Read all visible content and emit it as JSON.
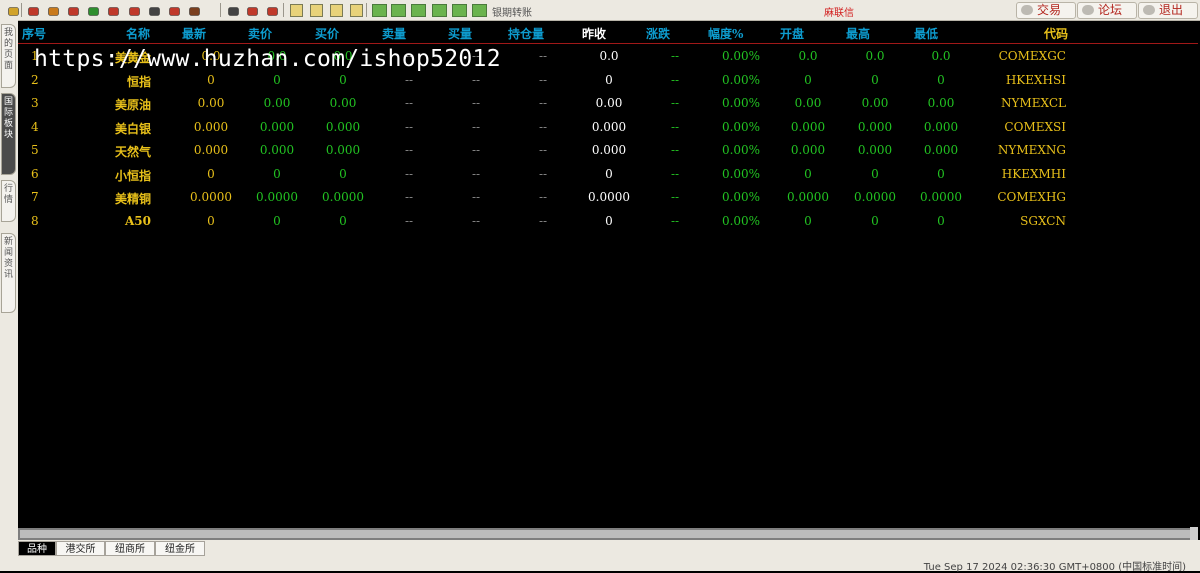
{
  "toolbar": {
    "icons": [
      "left-arrow",
      "home",
      "file",
      "chart-book",
      "refresh",
      "zoom-in",
      "zoom-out",
      "window",
      "pencil",
      "filter",
      "table",
      "line-chart",
      "trend-chart",
      "minute",
      "week",
      "month",
      "x",
      "add",
      "5",
      "15",
      "30",
      "60",
      "1h"
    ],
    "text_link": "银期转账",
    "login_link": "麻联信",
    "buttons": {
      "trade": "交易",
      "forum": "论坛",
      "exit": "退出"
    }
  },
  "side_tabs": [
    {
      "label": "我的页面"
    },
    {
      "label": "国际板块",
      "active": true
    },
    {
      "label": "行情"
    },
    {
      "label": "新闻资讯"
    }
  ],
  "table": {
    "headers": [
      "序号",
      "名称",
      "最新",
      "卖价",
      "买价",
      "卖量",
      "买量",
      "持仓量",
      "昨收",
      "涨跌",
      "幅度%",
      "开盘",
      "最高",
      "最低",
      "代码"
    ],
    "rows": [
      [
        "1",
        "美黄金",
        "0.0",
        "0.0",
        "0.0",
        "--",
        "--",
        "--",
        "0.0",
        "--",
        "0.00%",
        "0.0",
        "0.0",
        "0.0",
        "COMEXGC"
      ],
      [
        "2",
        "恒指",
        "0",
        "0",
        "0",
        "--",
        "--",
        "--",
        "0",
        "--",
        "0.00%",
        "0",
        "0",
        "0",
        "HKEXHSI"
      ],
      [
        "3",
        "美原油",
        "0.00",
        "0.00",
        "0.00",
        "--",
        "--",
        "--",
        "0.00",
        "--",
        "0.00%",
        "0.00",
        "0.00",
        "0.00",
        "NYMEXCL"
      ],
      [
        "4",
        "美白银",
        "0.000",
        "0.000",
        "0.000",
        "--",
        "--",
        "--",
        "0.000",
        "--",
        "0.00%",
        "0.000",
        "0.000",
        "0.000",
        "COMEXSI"
      ],
      [
        "5",
        "天然气",
        "0.000",
        "0.000",
        "0.000",
        "--",
        "--",
        "--",
        "0.000",
        "--",
        "0.00%",
        "0.000",
        "0.000",
        "0.000",
        "NYMEXNG"
      ],
      [
        "6",
        "小恒指",
        "0",
        "0",
        "0",
        "--",
        "--",
        "--",
        "0",
        "--",
        "0.00%",
        "0",
        "0",
        "0",
        "HKEXMHI"
      ],
      [
        "7",
        "美精铜",
        "0.0000",
        "0.0000",
        "0.0000",
        "--",
        "--",
        "--",
        "0.0000",
        "--",
        "0.00%",
        "0.0000",
        "0.0000",
        "0.0000",
        "COMEXHG"
      ],
      [
        "8",
        "A50",
        "0",
        "0",
        "0",
        "--",
        "--",
        "--",
        "0",
        "--",
        "0.00%",
        "0",
        "0",
        "0",
        "SGXCN"
      ]
    ]
  },
  "colors": {
    "header": "#0d9ccf",
    "code": "#e8c01a",
    "index": "#e8c01a",
    "name": "#e8c01a",
    "latest": "#e8c01a",
    "green": "#22c322",
    "white": "#ffffff",
    "gray": "#8a8a8a"
  },
  "watermark": "https://www.huzhan.com/ishop52012",
  "bottom_tabs": [
    {
      "label": "品种",
      "active": true
    },
    {
      "label": "港交所"
    },
    {
      "label": "纽商所"
    },
    {
      "label": "纽金所"
    }
  ],
  "status": {
    "time": "Tue Sep 17 2024 02:36:30 GMT+0800 (中国标准时间)"
  }
}
